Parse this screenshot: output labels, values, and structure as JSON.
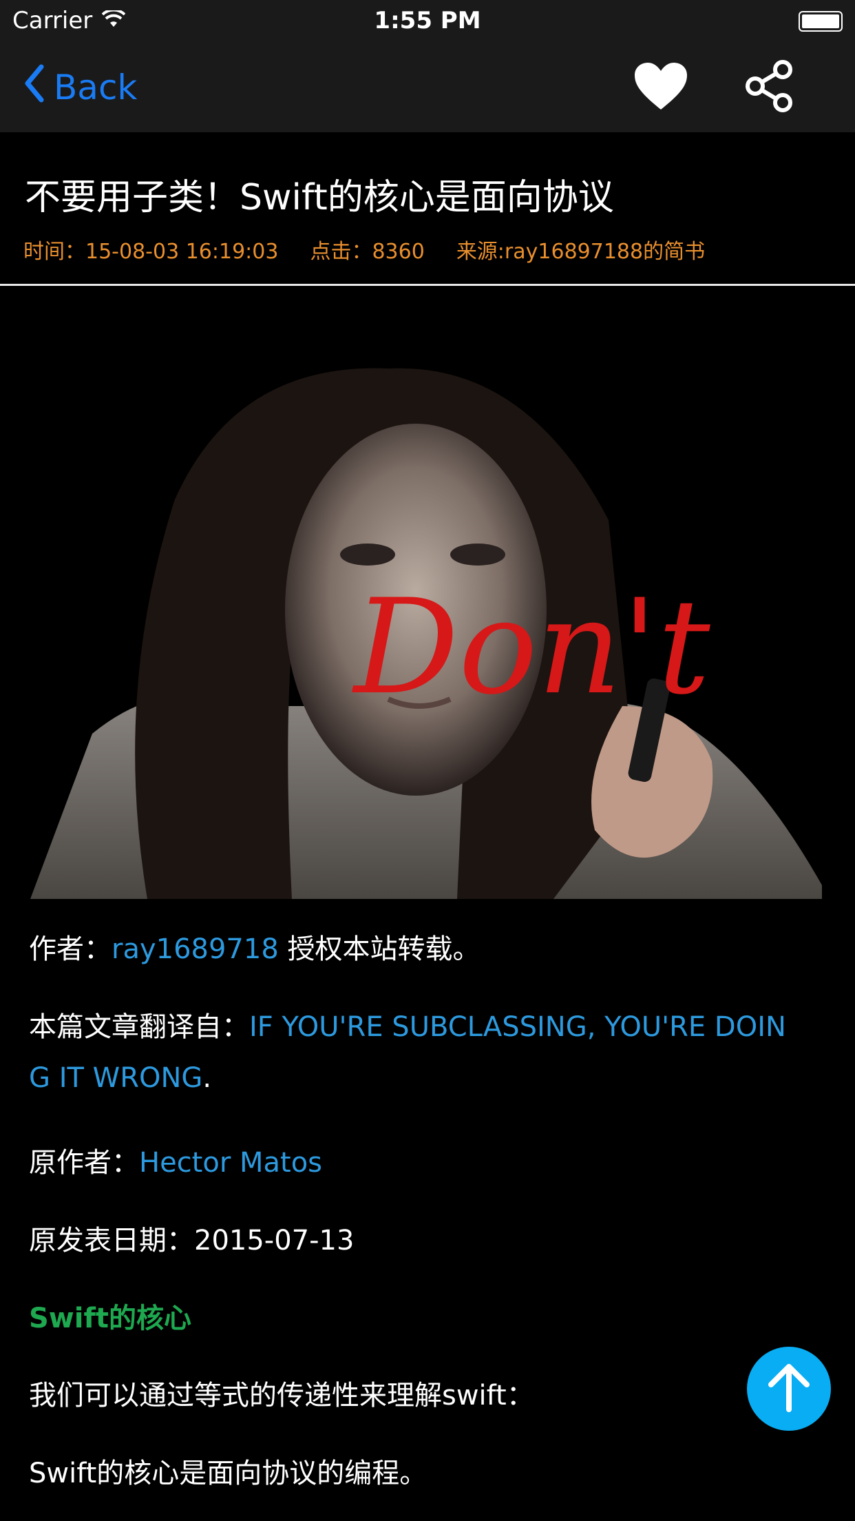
{
  "status_bar": {
    "carrier": "Carrier",
    "time": "1:55 PM"
  },
  "nav": {
    "back_label": "Back",
    "favorite_icon": "heart-icon",
    "share_icon": "share-icon",
    "accent_color": "#1a7cf5"
  },
  "article": {
    "title": "不要用子类！Swift的核心是面向协议",
    "meta": {
      "time": "时间：15-08-03 16:19:03",
      "clicks": "点击：8360",
      "source": "来源:ray16897188的简书"
    },
    "hero_image_caption": "Don't"
  },
  "content": {
    "author_prefix": "作者：",
    "author_link": "ray1689718",
    "author_suffix": " 授权本站转载。",
    "translated_prefix": "本篇文章翻译自：",
    "translated_link_line1": "IF YOU'RE SUBCLASSING, YOU'RE DOIN",
    "translated_link_line2": "G IT WRONG",
    "translated_suffix": ".",
    "original_author_prefix": "原作者：",
    "original_author_link": "Hector Matos",
    "publish_date": "原发表日期：2015-07-13",
    "section_heading": "Swift的核心",
    "para1": "我们可以通过等式的传递性来理解swift：",
    "para2": "Swift的核心是面向协议的编程。"
  },
  "scroll_top_icon": "arrow-up-icon",
  "colors": {
    "meta": "#e98f2e",
    "link": "#2d9adf",
    "heading": "#1ea850",
    "fab": "#08adf3"
  }
}
